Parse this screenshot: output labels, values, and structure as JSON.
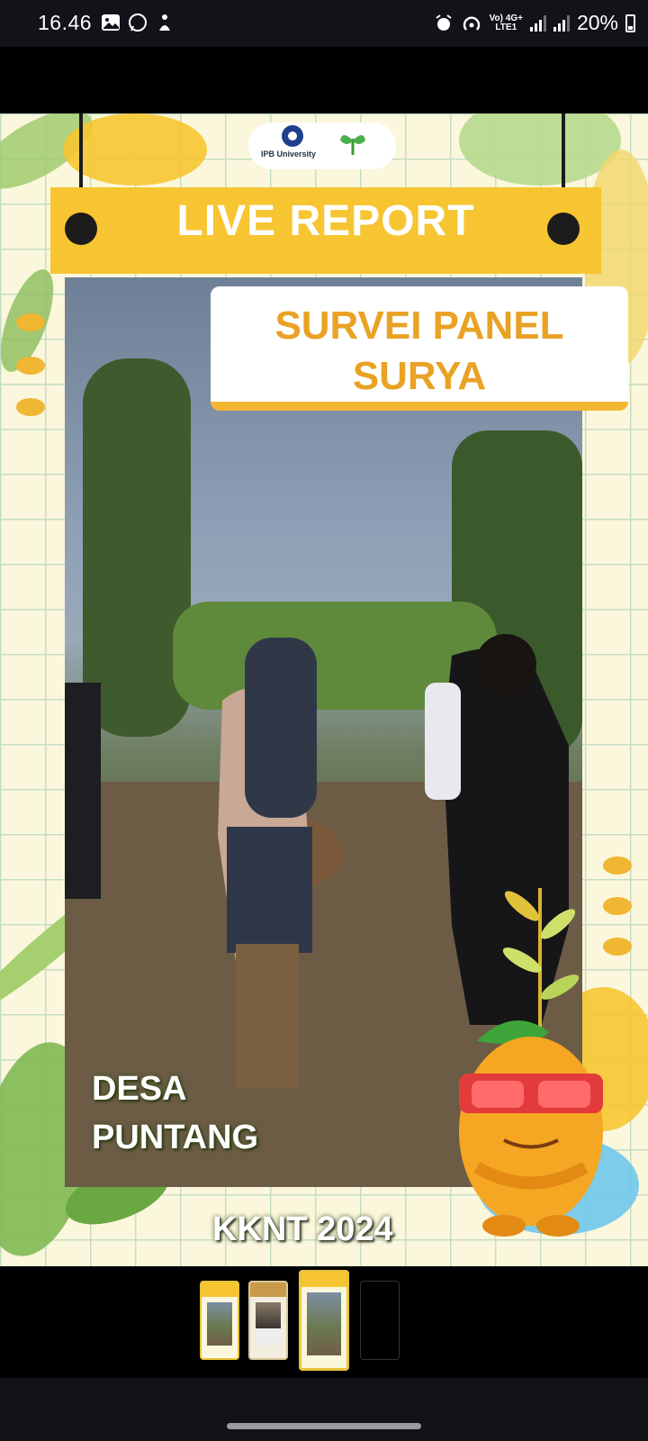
{
  "status_bar": {
    "time": "16.46",
    "network_label_top": "Vo) 4G+",
    "network_label_bottom": "LTE1",
    "battery": "20%",
    "icons": [
      "image-notification-icon",
      "whatsapp-icon",
      "download-icon",
      "alarm-icon",
      "hotspot-icon",
      "signal-icon",
      "signal-icon",
      "battery-icon"
    ]
  },
  "story": {
    "banner": "LIVE REPORT",
    "title_line1": "SURVEI PANEL",
    "title_line2": "SURYA",
    "location_line1": "DESA",
    "location_line2": "PUNTANG",
    "footer": "KKNT 2024",
    "logo_caption": "IPB University"
  },
  "thumbnails": [
    {
      "name": "thumbnail-1",
      "selected": false
    },
    {
      "name": "thumbnail-2",
      "selected": false
    },
    {
      "name": "thumbnail-3",
      "selected": true
    },
    {
      "name": "thumbnail-4-empty",
      "selected": false
    }
  ],
  "colors": {
    "banner_yellow": "#f6c531",
    "title_orange": "#e9a224",
    "background": "#000000"
  }
}
